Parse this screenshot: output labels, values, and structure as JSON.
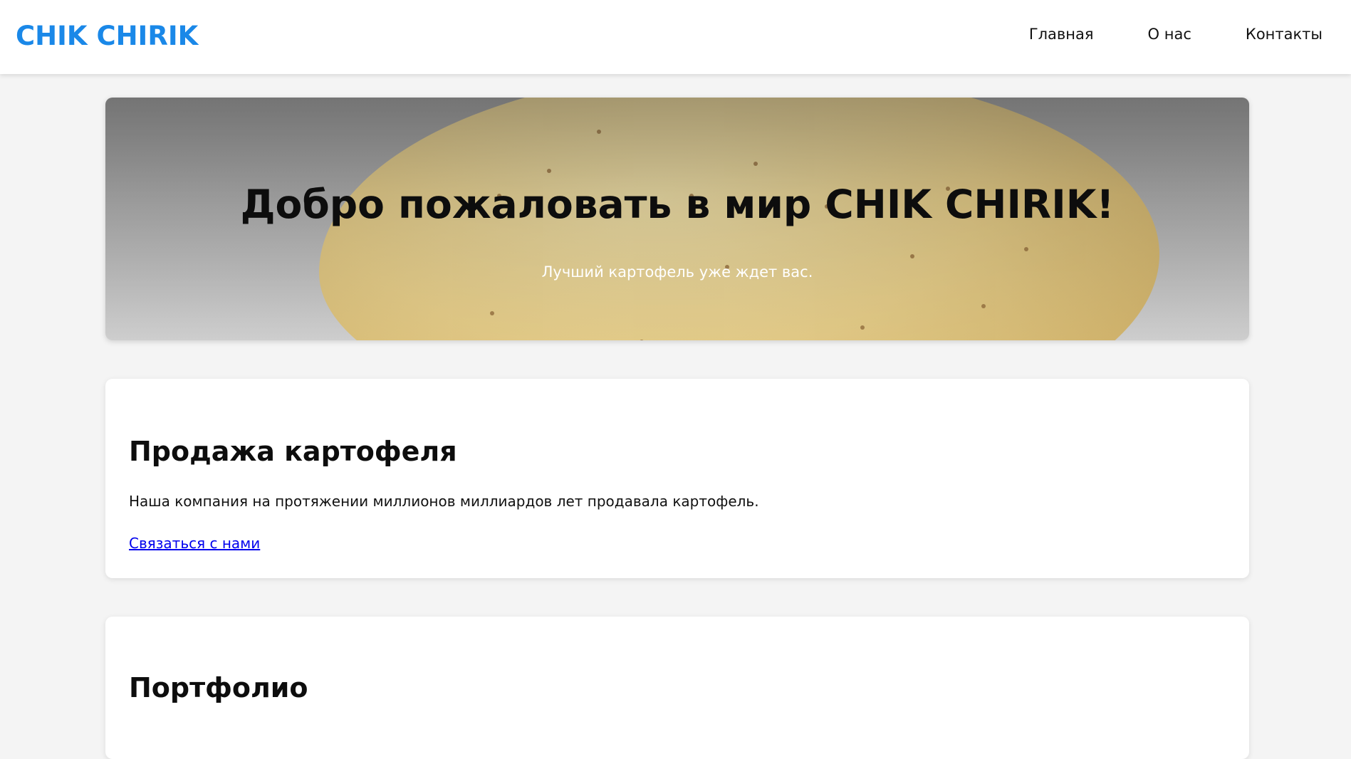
{
  "header": {
    "logo": "CHIK CHIRIK",
    "nav": [
      {
        "label": "Главная"
      },
      {
        "label": "О нас"
      },
      {
        "label": "Контакты"
      }
    ]
  },
  "hero": {
    "title": "Добро пожаловать в мир CHIK CHIRIK!",
    "subtitle": "Лучший картофель уже ждет вас.",
    "image_icon": "potato-image"
  },
  "sections": [
    {
      "title": "Продажа картофеля",
      "text": "Наша компания на протяжении миллионов миллиардов лет продавала картофель.",
      "link": "Связаться с нами"
    },
    {
      "title": "Портфолио"
    }
  ],
  "colors": {
    "brand": "#1a88e8",
    "link": "#0000ee"
  }
}
